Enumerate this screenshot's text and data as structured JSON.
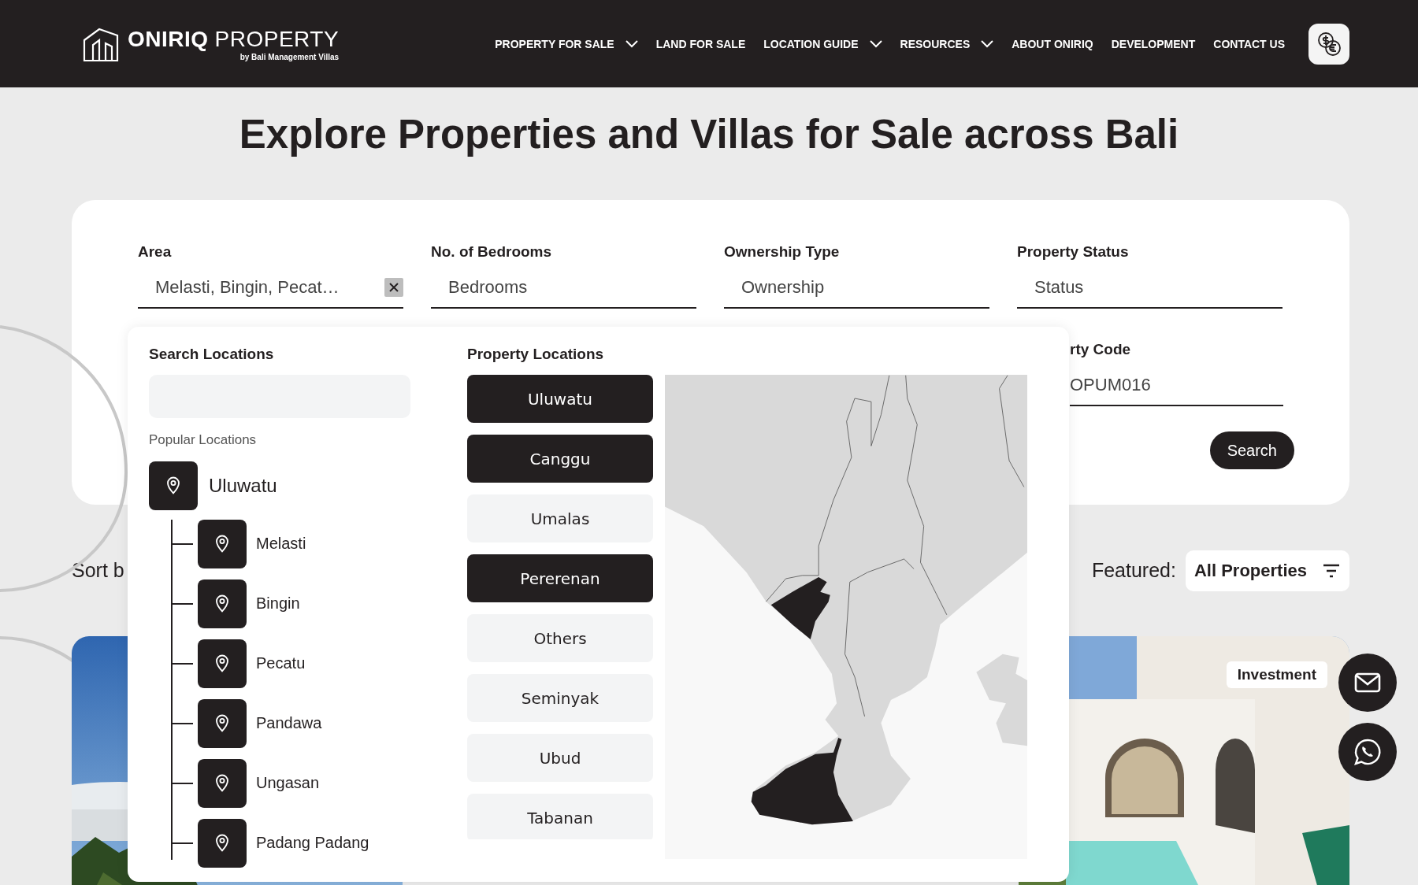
{
  "header": {
    "logo": {
      "brand_bold": "ONIRIQ",
      "brand_light": "PROPERTY",
      "tagline": "by Bali Management Villas"
    },
    "nav": [
      {
        "label": "PROPERTY FOR SALE",
        "dropdown": true
      },
      {
        "label": "LAND FOR SALE",
        "dropdown": false
      },
      {
        "label": "LOCATION GUIDE",
        "dropdown": true
      },
      {
        "label": "RESOURCES",
        "dropdown": true
      },
      {
        "label": "ABOUT ONIRIQ",
        "dropdown": false
      },
      {
        "label": "DEVELOPMENT",
        "dropdown": false
      },
      {
        "label": "CONTACT US",
        "dropdown": false
      }
    ]
  },
  "title": "Explore Properties and Villas for Sale across Bali",
  "filters": {
    "fields": [
      {
        "label": "Area",
        "value": "Melasti, Bingin, Pecat…",
        "clearable": true
      },
      {
        "label": "No. of Bedrooms",
        "placeholder": "Bedrooms",
        "clearable": false
      },
      {
        "label": "Ownership Type",
        "placeholder": "Ownership",
        "clearable": false
      },
      {
        "label": "Property Status",
        "placeholder": "Status",
        "clearable": false
      }
    ],
    "code_field": {
      "label": "rty Code",
      "value": "OPUM016"
    },
    "search_button": "Search"
  },
  "sort": {
    "label": "Sort b",
    "featured_label": "Featured:",
    "dropdown": "All Properties"
  },
  "listings": [
    {
      "kind": "picture"
    },
    {
      "kind": "picture",
      "badge": "Investment"
    }
  ],
  "location_dropdown": {
    "search_title": "Search Locations",
    "popular_title": "Popular Locations",
    "tree": [
      {
        "label": "Uluwatu",
        "children": [
          {
            "label": "Melasti"
          },
          {
            "label": "Bingin"
          },
          {
            "label": "Pecatu"
          },
          {
            "label": "Pandawa"
          },
          {
            "label": "Ungasan"
          },
          {
            "label": "Padang Padang"
          }
        ]
      }
    ],
    "locations_title": "Property Locations",
    "locations": [
      {
        "label": "Uluwatu",
        "selected": true
      },
      {
        "label": "Canggu",
        "selected": true
      },
      {
        "label": "Umalas",
        "selected": false
      },
      {
        "label": "Pererenan",
        "selected": true
      },
      {
        "label": "Others",
        "selected": false
      },
      {
        "label": "Seminyak",
        "selected": false
      },
      {
        "label": "Ubud",
        "selected": false
      },
      {
        "label": "Tabanan",
        "selected": false
      }
    ]
  }
}
